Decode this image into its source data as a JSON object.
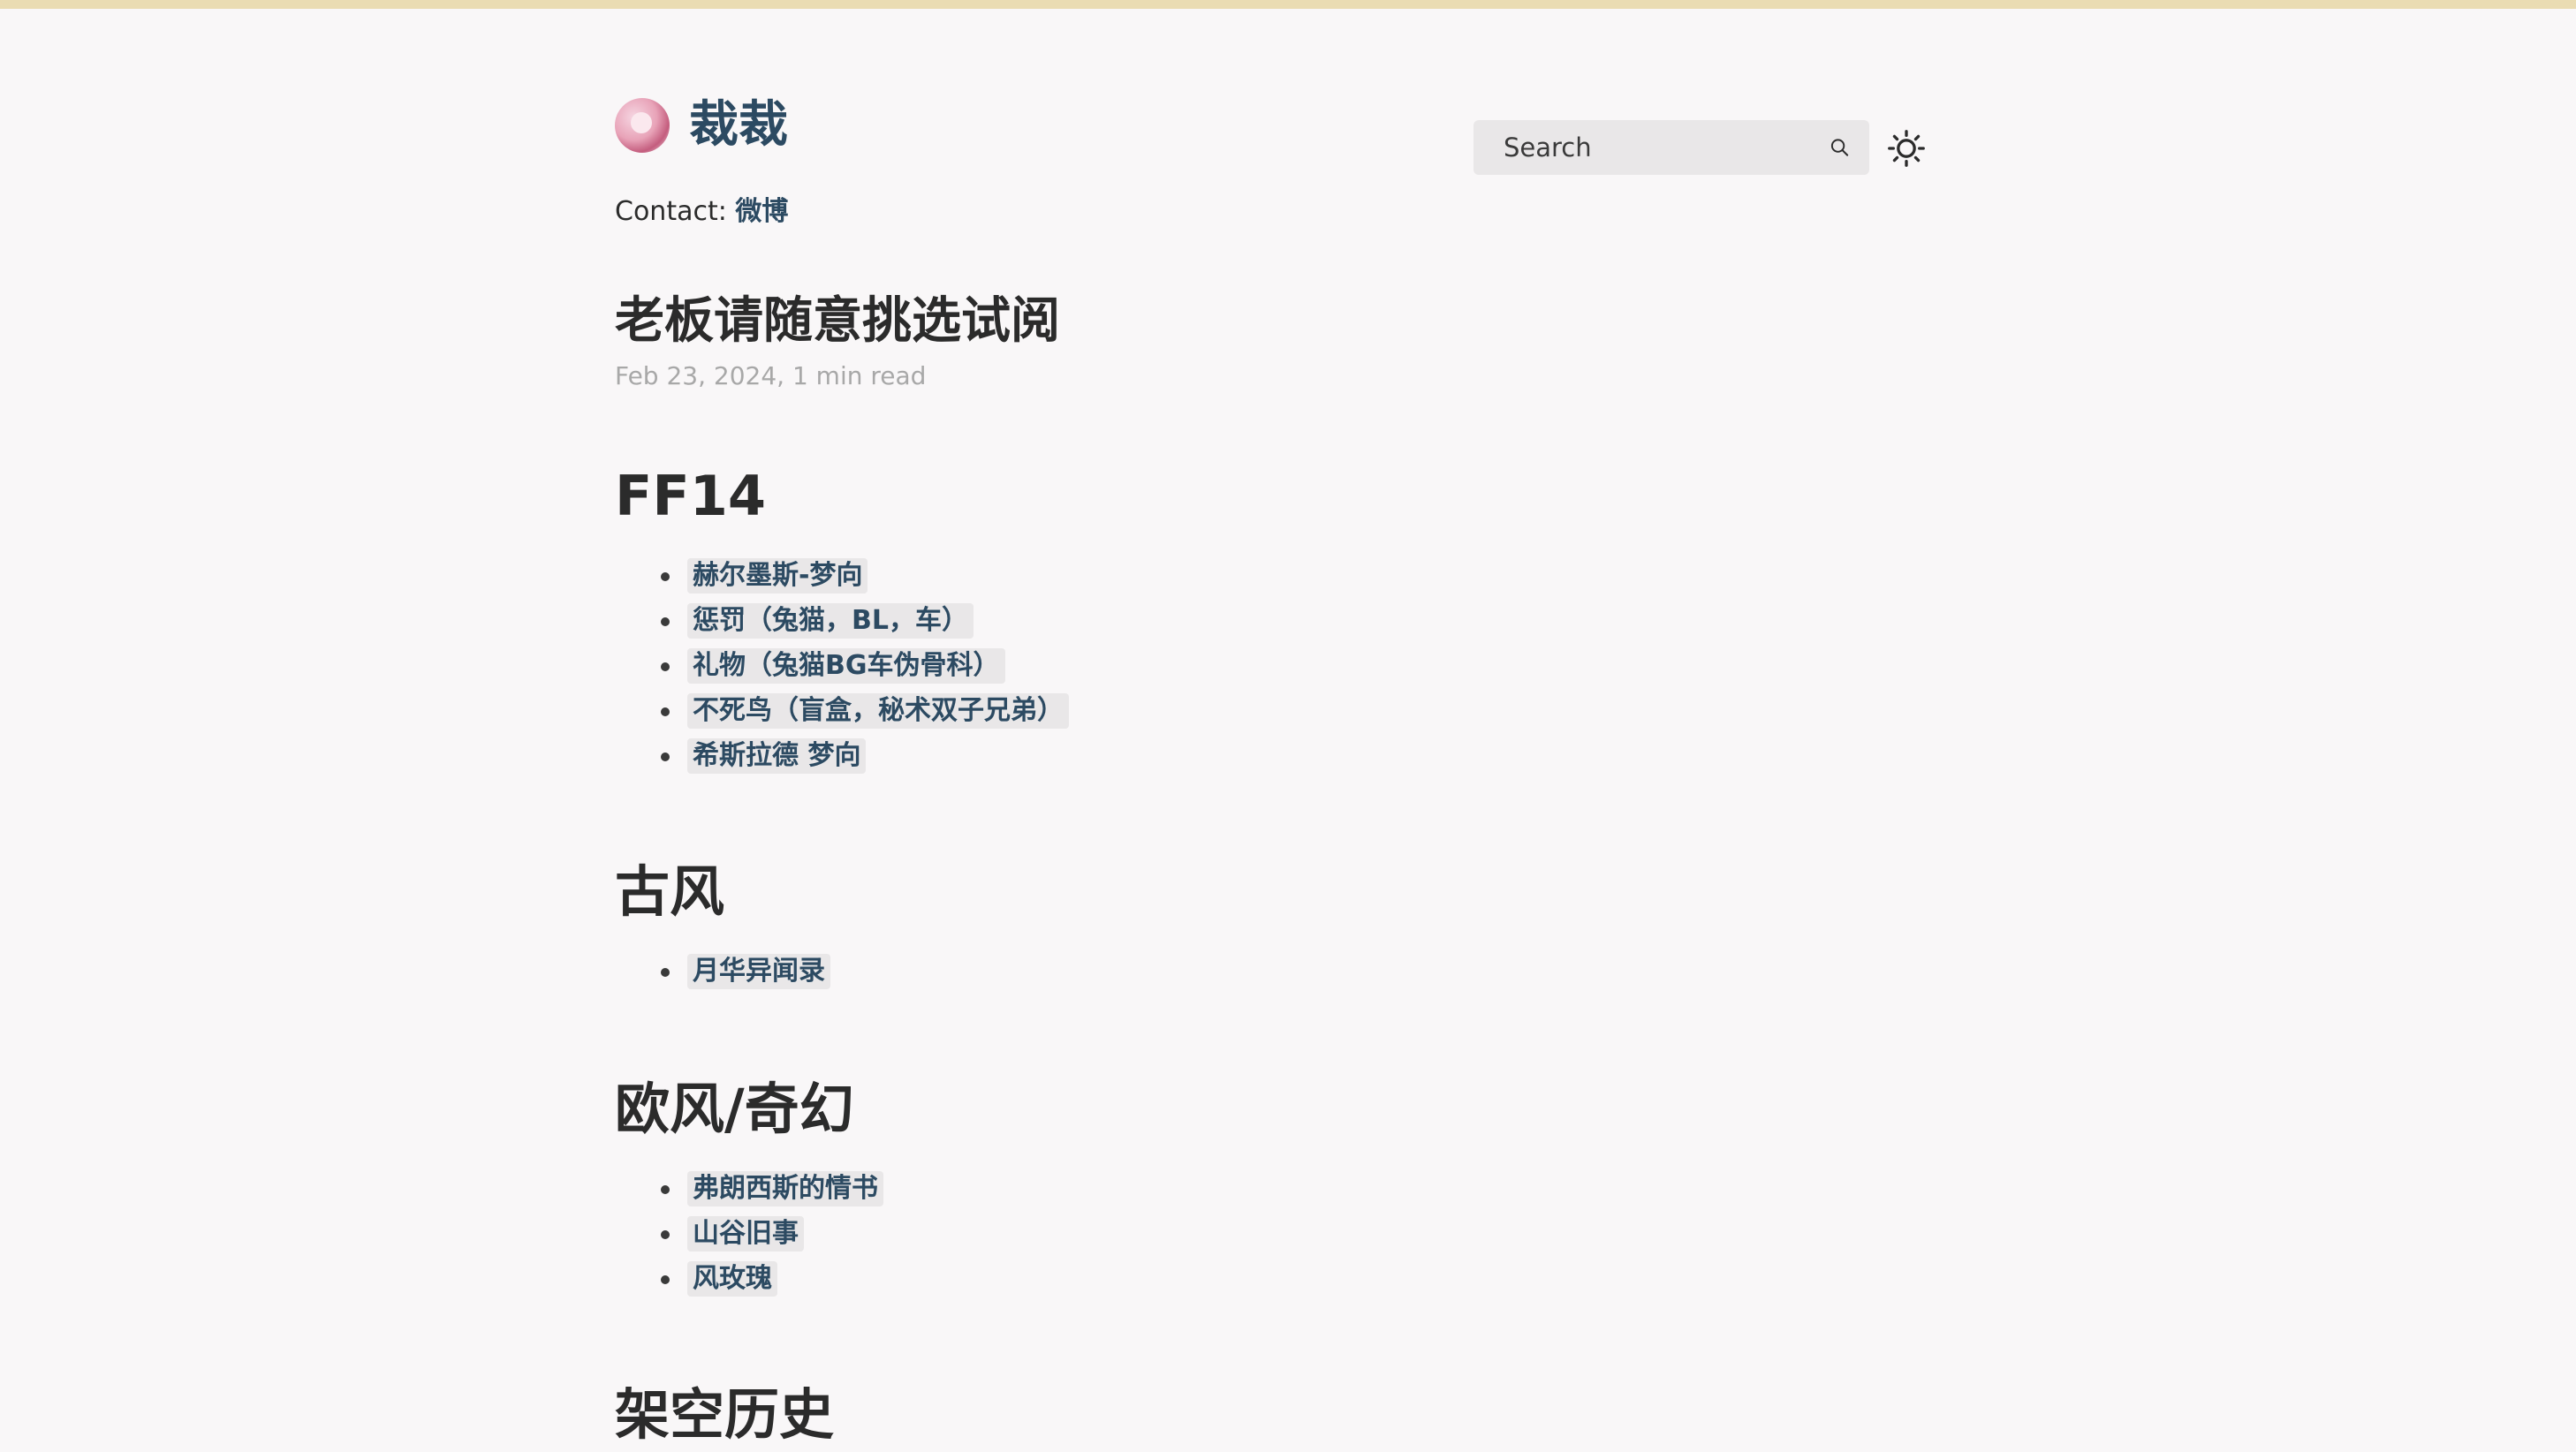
{
  "site": {
    "title": "裁裁",
    "contact_label": "Contact: ",
    "contact_link": "微博"
  },
  "search": {
    "placeholder": "Search"
  },
  "icons": {
    "search": "search-icon",
    "theme": "sun-icon"
  },
  "post": {
    "title": "老板请随意挑选试阅",
    "meta": "Feb 23, 2024, 1 min read"
  },
  "sections": [
    {
      "heading": "FF14",
      "items": [
        "赫尔墨斯-梦向",
        "惩罚（兔猫，BL，车）",
        "礼物（兔猫BG车伪骨科）",
        "不死鸟（盲盒，秘术双子兄弟）",
        "希斯拉德 梦向"
      ]
    },
    {
      "heading": "古风",
      "items": [
        "月华异闻录"
      ]
    },
    {
      "heading": "欧风/奇幻",
      "items": [
        "弗朗西斯的情书",
        "山谷旧事",
        "风玫瑰"
      ]
    },
    {
      "heading": "架空历史",
      "items": []
    }
  ]
}
